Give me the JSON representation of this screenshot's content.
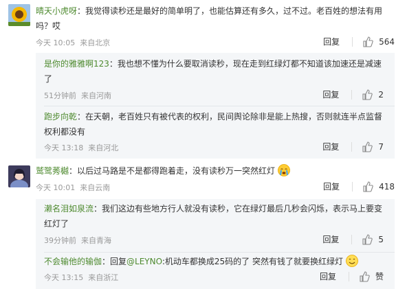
{
  "comments": [
    {
      "user": "晴天小虎呀",
      "text": "：我觉得读秒还是最好的简单明了，也能估算还有多久，过不过。老百姓的想法有用吗？哎",
      "time": "今天 10:05",
      "location": "来自北京",
      "reply_label": "回复",
      "likes": "564",
      "replies": [
        {
          "user": "是你的雅雅啊123",
          "text": "：我也想不懂为什么要取消读秒，现在走到红绿灯都不知道该加速还是减速了",
          "time": "51分钟前",
          "location": "来自河南",
          "reply_label": "回复",
          "likes": "2"
        },
        {
          "user": "跑步向乾",
          "text": "：在天朝，老百姓只有被代表的权利，民间舆论除非是能上热搜，否则就连半点监督权利都没有",
          "time": "今天 13:18",
          "location": "来自河北",
          "reply_label": "回复",
          "likes": "7"
        }
      ]
    },
    {
      "user": "鹫鹭莠樾",
      "text": "：以后过马路是不是都得跑着走，没有读秒万一突然红灯",
      "time": "今天 10:01",
      "location": "来自云南",
      "reply_label": "回复",
      "likes": "418",
      "replies": [
        {
          "user": "濑名泪如泉流",
          "text": "：我们这边有些地方行人就没有读秒，它在绿灯最后几秒会闪烁，表示马上要变红灯了",
          "time": "39分钟前",
          "location": "来自青海",
          "reply_label": "回复",
          "likes": "5"
        },
        {
          "user": "不会输他的输伽",
          "reply_prefix": "：回复",
          "mention": "@LEYNO",
          "text": ":机动车都换成25码的了 突然有钱了就要换红绿灯",
          "time": "今天 13:15",
          "location": "来自浙江",
          "reply_label": "回复",
          "likes": "赞"
        }
      ]
    }
  ],
  "colors": {
    "username": "#4e8a2f",
    "meta": "#999999",
    "sub_bg": "#f4f6f8"
  },
  "icons": [
    "sunflower-avatar",
    "girl-avatar",
    "like-icon",
    "crying-emoji",
    "smile-emoji"
  ]
}
